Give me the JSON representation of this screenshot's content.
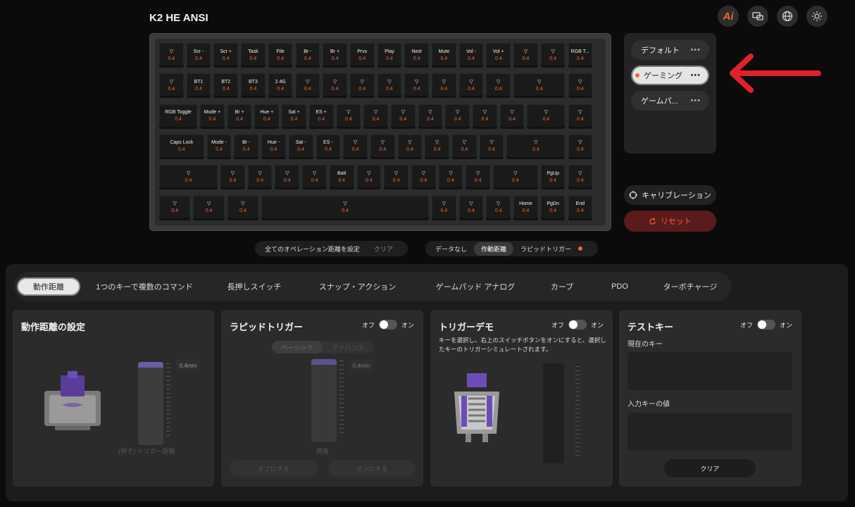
{
  "app": {
    "title": "K2 HE ANSI"
  },
  "top_icons": {
    "ai_label": "Ai",
    "icons": [
      "ai-icon",
      "monitor-icon",
      "globe-icon",
      "brightness-icon"
    ]
  },
  "keyboard": {
    "rows": [
      [
        {
          "l": "▽",
          "v": "0.4"
        },
        {
          "l": "Scr -",
          "v": "0.4"
        },
        {
          "l": "Scr +",
          "v": "0.4"
        },
        {
          "l": "Task",
          "v": "0.4"
        },
        {
          "l": "File",
          "v": "0.4"
        },
        {
          "l": "Br -",
          "v": "0.4"
        },
        {
          "l": "Br +",
          "v": "0.4"
        },
        {
          "l": "Prvs",
          "v": "0.4"
        },
        {
          "l": "Play",
          "v": "0.4"
        },
        {
          "l": "Next",
          "v": "0.4"
        },
        {
          "l": "Mute",
          "v": "0.4"
        },
        {
          "l": "Vol -",
          "v": "0.4"
        },
        {
          "l": "Vol +",
          "v": "0.4"
        },
        {
          "l": "▽",
          "v": "0.4"
        },
        {
          "l": "▽",
          "v": "0.4"
        },
        {
          "l": "RGB T...",
          "v": "0.4"
        }
      ],
      [
        {
          "l": "▽",
          "v": "0.4"
        },
        {
          "l": "BT1",
          "v": "0.4"
        },
        {
          "l": "BT2",
          "v": "0.4"
        },
        {
          "l": "BT3",
          "v": "0.4"
        },
        {
          "l": "2.4G",
          "v": "0.4"
        },
        {
          "l": "▽",
          "v": "0.4"
        },
        {
          "l": "▽",
          "v": "0.4"
        },
        {
          "l": "▽",
          "v": "0.4"
        },
        {
          "l": "▽",
          "v": "0.4"
        },
        {
          "l": "▽",
          "v": "0.4"
        },
        {
          "l": "▽",
          "v": "0.4"
        },
        {
          "l": "▽",
          "v": "0.4"
        },
        {
          "l": "▽",
          "v": "0.4"
        },
        {
          "l": "▽",
          "v": "0.4"
        },
        {
          "l": "▽",
          "v": "0.4"
        }
      ],
      [
        {
          "l": "RGB Toggle",
          "v": "0.4"
        },
        {
          "l": "Mode +",
          "v": "0.4"
        },
        {
          "l": "Br +",
          "v": "0.4"
        },
        {
          "l": "Hue +",
          "v": "0.4"
        },
        {
          "l": "Sat +",
          "v": "0.4"
        },
        {
          "l": "ES +",
          "v": "0.4"
        },
        {
          "l": "▽",
          "v": "0.4"
        },
        {
          "l": "▽",
          "v": "0.4"
        },
        {
          "l": "▽",
          "v": "0.4"
        },
        {
          "l": "▽",
          "v": "0.4"
        },
        {
          "l": "▽",
          "v": "0.4"
        },
        {
          "l": "▽",
          "v": "0.4"
        },
        {
          "l": "▽",
          "v": "0.4"
        },
        {
          "l": "▽",
          "v": "0.4"
        },
        {
          "l": "▽",
          "v": "0.4"
        }
      ],
      [
        {
          "l": "Caps Lock",
          "v": "0.4"
        },
        {
          "l": "Mode -",
          "v": "0.4"
        },
        {
          "l": "Br -",
          "v": "0.4"
        },
        {
          "l": "Hue -",
          "v": "0.4"
        },
        {
          "l": "Sat -",
          "v": "0.4"
        },
        {
          "l": "ES -",
          "v": "0.4"
        },
        {
          "l": "▽",
          "v": "0.4"
        },
        {
          "l": "▽",
          "v": "0.4"
        },
        {
          "l": "▽",
          "v": "0.4"
        },
        {
          "l": "▽",
          "v": "0.4"
        },
        {
          "l": "▽",
          "v": "0.4"
        },
        {
          "l": "▽",
          "v": "0.4"
        },
        {
          "l": "▽",
          "v": "0.4"
        },
        {
          "l": "▽",
          "v": "0.4"
        }
      ],
      [
        {
          "l": "▽",
          "v": "0.4"
        },
        {
          "l": "▽",
          "v": "0.4"
        },
        {
          "l": "▽",
          "v": "0.4"
        },
        {
          "l": "▽",
          "v": "0.4"
        },
        {
          "l": "▽",
          "v": "0.4"
        },
        {
          "l": "Batt",
          "v": "0.4"
        },
        {
          "l": "▽",
          "v": "0.4"
        },
        {
          "l": "▽",
          "v": "0.4"
        },
        {
          "l": "▽",
          "v": "0.4"
        },
        {
          "l": "▽",
          "v": "0.4"
        },
        {
          "l": "▽",
          "v": "0.4"
        },
        {
          "l": "▽",
          "v": "0.4"
        },
        {
          "l": "PgUp",
          "v": "0.4"
        },
        {
          "l": "▽",
          "v": "0.4"
        }
      ],
      [
        {
          "l": "▽",
          "v": "0.4"
        },
        {
          "l": "▽",
          "v": "0.4"
        },
        {
          "l": "▽",
          "v": "0.4"
        },
        {
          "l": "▽",
          "v": "0.4"
        },
        {
          "l": "▽",
          "v": "0.4"
        },
        {
          "l": "▽",
          "v": "0.4"
        },
        {
          "l": "▽",
          "v": "0.4"
        },
        {
          "l": "Home",
          "v": "0.4"
        },
        {
          "l": "PgDn",
          "v": "0.4"
        },
        {
          "l": "End",
          "v": "0.4"
        }
      ]
    ]
  },
  "profiles": {
    "items": [
      {
        "name": "デフォルト",
        "active": false
      },
      {
        "name": "ゲーミング",
        "active": true
      },
      {
        "name": "ゲームパ...",
        "active": false
      }
    ],
    "more": "•••"
  },
  "actions": {
    "calibration": "キャリブレーション",
    "reset": "リセット"
  },
  "operation_bar": {
    "set_all": "全てのオペレーション距離を設定",
    "clear": "クリア"
  },
  "view_bar": {
    "no_data": "データなし",
    "actuation": "作動距離",
    "rapid_trigger": "ラピッドトリガー"
  },
  "tabs": [
    "動作距離",
    "1つのキーで複数のコマンド",
    "長押しスイッチ",
    "スナップ・アクション",
    "ゲームパッド アナログ",
    "カーブ",
    "PDO",
    "ターボチャージ"
  ],
  "card_actuation": {
    "title": "動作距離の設定",
    "value": "0.4mm",
    "caption": "(押す) トリガー距離"
  },
  "card_rapid": {
    "title": "ラピッドトリガー",
    "off": "オフ",
    "on": "オン",
    "basic": "ベーシック",
    "advanced": "アドバンス",
    "value": "0.4mm",
    "caption": "感度",
    "btn_off": "オフにする",
    "btn_on": "オンにする"
  },
  "card_demo": {
    "title": "トリガーデモ",
    "off": "オフ",
    "on": "オン",
    "desc": "キーを選択し、右上のスイッチボタンをオンにすると、選択したキーのトリガーシミュレートされます。"
  },
  "card_test": {
    "title": "テストキー",
    "off": "オフ",
    "on": "オン",
    "current_key": "現在のキー",
    "input_value": "入力キーの値",
    "clear": "クリア"
  },
  "colors": {
    "accent": "#f06a2a",
    "arrow": "#e0202a"
  }
}
